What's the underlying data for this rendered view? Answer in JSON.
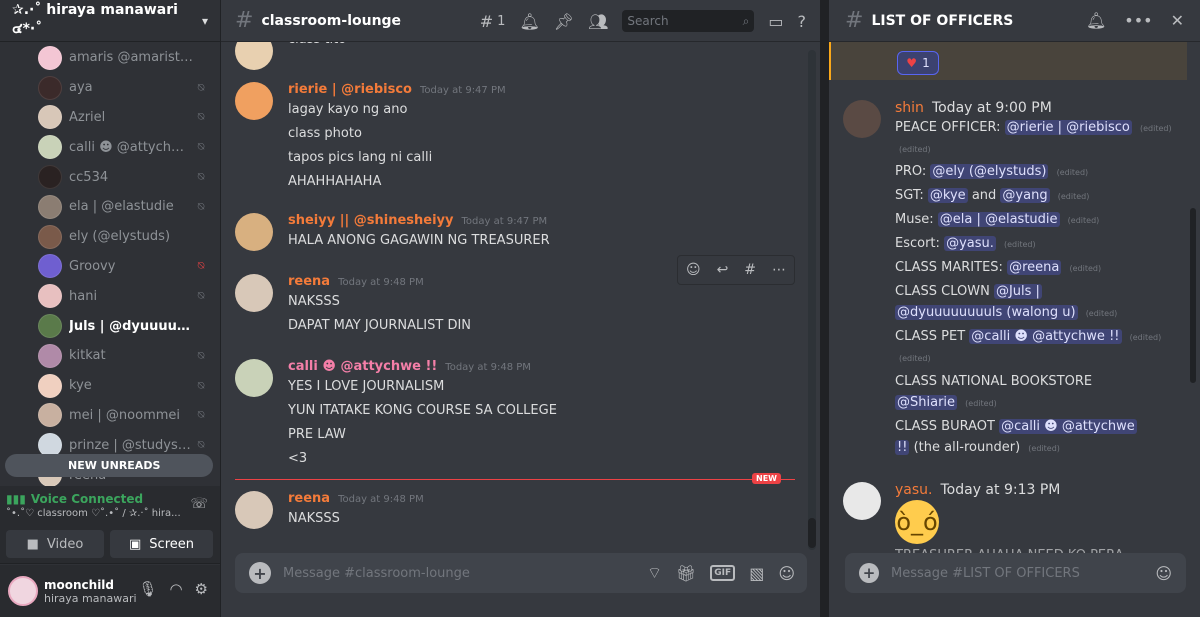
{
  "server": {
    "name": "✰.·˚ hiraya manawari ๔*·˚"
  },
  "members": [
    {
      "name": "amaris @amaristudy",
      "color": "#f3c6d4",
      "mic": "",
      "active": false
    },
    {
      "name": "aya",
      "color": "#3b2a2a",
      "mic": "⍉",
      "active": false
    },
    {
      "name": "Azriel",
      "color": "#d8c7b8",
      "mic": "⍉",
      "active": false
    },
    {
      "name": "calli ☻ @attychwe !!",
      "color": "#c9d2b8",
      "mic": "⍉",
      "active": false
    },
    {
      "name": "cc534",
      "color": "#2a2222",
      "mic": "⍉",
      "active": false
    },
    {
      "name": "ela | @elastudie",
      "color": "#8b7d72",
      "mic": "⍉",
      "active": false
    },
    {
      "name": "ely (@elystuds)",
      "color": "#7a5a4a",
      "mic": "",
      "active": false
    },
    {
      "name": "Groovy",
      "color": "#6f5fd0",
      "mic": "⍉",
      "active": false,
      "red": true
    },
    {
      "name": "hani",
      "color": "#e8c0c0",
      "mic": "⍉",
      "active": false
    },
    {
      "name": "Juls | @dyuuuuuuuuls (w...",
      "color": "#5a7a4a",
      "mic": "",
      "active": true
    },
    {
      "name": "kitkat",
      "color": "#b08aa8",
      "mic": "⍉",
      "active": false
    },
    {
      "name": "kye",
      "color": "#f0d0c0",
      "mic": "⍉",
      "active": false
    },
    {
      "name": "mei | @noommei",
      "color": "#c8b0a0",
      "mic": "⍉",
      "active": false
    },
    {
      "name": "prinze | @studysng",
      "color": "#d0d8e0",
      "mic": "⍉",
      "active": false
    },
    {
      "name": "reena",
      "color": "#d8c8b8",
      "mic": "",
      "active": false
    }
  ],
  "sidebar": {
    "new_unreads": "NEW UNREADS",
    "voice_status": "Voice Connected",
    "voice_channel": "˚•.˚♡ classroom ♡˚.•˚ / ✰.·˚ hira...",
    "video_label": "Video",
    "screen_label": "Screen"
  },
  "user": {
    "name": "moonchild",
    "tag": "hiraya manawari"
  },
  "channel": {
    "name": "classroom-lounge",
    "threads_count": "1",
    "search_placeholder": "Search",
    "message_placeholder": "Message #classroom-lounge"
  },
  "messages": [
    {
      "author": "",
      "time": "",
      "lines": [
        "class tito"
      ],
      "color": "#e8d0b0"
    },
    {
      "author": "rierie | @riebisco",
      "time": "Today at 9:47 PM",
      "lines": [
        "lagay kayo ng ano",
        "class photo",
        "tapos pics lang ni calli",
        "AHAHHAHAHA"
      ],
      "author_color": "#f47b3a",
      "color": "#f0a060"
    },
    {
      "author": "sheiyy || @shinesheiyy",
      "time": "Today at 9:47 PM",
      "lines": [
        "HALA ANONG GAGAWIN NG TREASURER"
      ],
      "author_color": "#f47b3a",
      "color": "#d8b080"
    },
    {
      "author": "reena",
      "time": "Today at 9:48 PM",
      "lines": [
        "NAKSSS",
        "DAPAT MAY JOURNALIST DIN"
      ],
      "author_color": "#f47b3a",
      "color": "#d8c8b8"
    },
    {
      "author": "calli ☻ @attychwe !!",
      "time": "Today at 9:48 PM",
      "lines": [
        "YES I LOVE JOURNALISM",
        "YUN ITATAKE KONG COURSE SA COLLEGE",
        "PRE LAW",
        "<3"
      ],
      "author_color": "#f47fa8",
      "color": "#c9d2b8"
    },
    {
      "author": "reena",
      "time": "Today at 9:48 PM",
      "lines": [
        "NAKSSS"
      ],
      "author_color": "#f47b3a",
      "color": "#d8c8b8"
    }
  ],
  "new_label": "NEW",
  "thread": {
    "title": "LIST OF OFFICERS",
    "message_placeholder": "Message #LIST OF OFFICERS",
    "reaction_count": "1",
    "shin": {
      "author": "shin",
      "time": "Today at 9:00 PM"
    },
    "edited": "(edited)",
    "officers": [
      {
        "label": "PEACE OFFICER:",
        "mentions": [
          "@rierie | @riebisco"
        ]
      },
      {
        "label": "PRO:",
        "mentions": [
          "@ely (@elystuds)"
        ]
      },
      {
        "label": "SGT:",
        "mentions": [
          "@kye",
          "@yang"
        ],
        "joiner": "and"
      },
      {
        "label": "Muse:",
        "mentions": [
          "@ela | @elastudie"
        ]
      },
      {
        "label": "Escort:",
        "mentions": [
          "@yasu."
        ]
      },
      {
        "label": "CLASS MARITES:",
        "mentions": [
          "@reena"
        ]
      },
      {
        "label": "CLASS CLOWN",
        "mentions": [
          "@Juls |"
        ],
        "line2": "@dyuuuuuuuuls (walong u)"
      },
      {
        "label": "CLASS PET",
        "mentions": [
          "@calli ☻ @attychwe !!"
        ]
      },
      {
        "label": "CLASS NATIONAL BOOKSTORE",
        "mentions": [],
        "line2": "@Shiarie"
      },
      {
        "label": "CLASS BURAOT",
        "mentions": [
          "@calli ☻ @attychwe"
        ],
        "line2": "!!",
        "line2_suffix": "(the all-rounder)"
      }
    ],
    "yasu": {
      "author": "yasu.",
      "time": "Today at 9:13 PM"
    },
    "cut_text": "TREASURER AHAHA NEED KO PERA"
  },
  "colors": {
    "accent": "#5865f2",
    "orange_author": "#f47b3a",
    "online": "#3ba55d",
    "danger": "#ed4245"
  }
}
